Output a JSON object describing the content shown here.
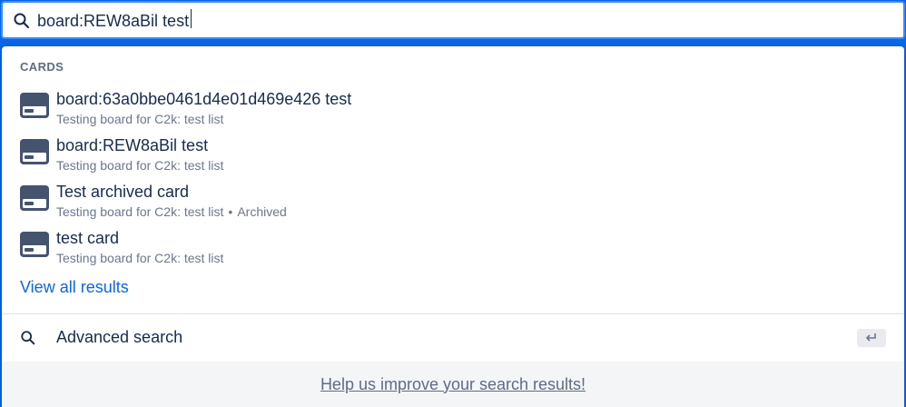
{
  "search": {
    "value": "board:REW8aBil test",
    "placeholder": ""
  },
  "section": {
    "heading": "CARDS"
  },
  "results": [
    {
      "title": "board:63a0bbe0461d4e01d469e426 test",
      "subtitle": "Testing board for C2k: test list",
      "status": ""
    },
    {
      "title": "board:REW8aBil test",
      "subtitle": "Testing board for C2k: test list",
      "status": ""
    },
    {
      "title": "Test archived card",
      "subtitle": "Testing board for C2k: test list",
      "status": "Archived"
    },
    {
      "title": "test card",
      "subtitle": "Testing board for C2k: test list",
      "status": ""
    }
  ],
  "separator": "•",
  "view_all": "View all results",
  "advanced_search": {
    "label": "Advanced search",
    "shortcut_icon": "enter-key-icon"
  },
  "footer": {
    "feedback": "Help us improve your search results!"
  },
  "icons": {
    "search": "search-icon",
    "card": "card-icon"
  },
  "colors": {
    "accent": "#0c66e4",
    "focus_border": "#388bff",
    "icon": "#44546f",
    "muted": "#6b778c"
  }
}
